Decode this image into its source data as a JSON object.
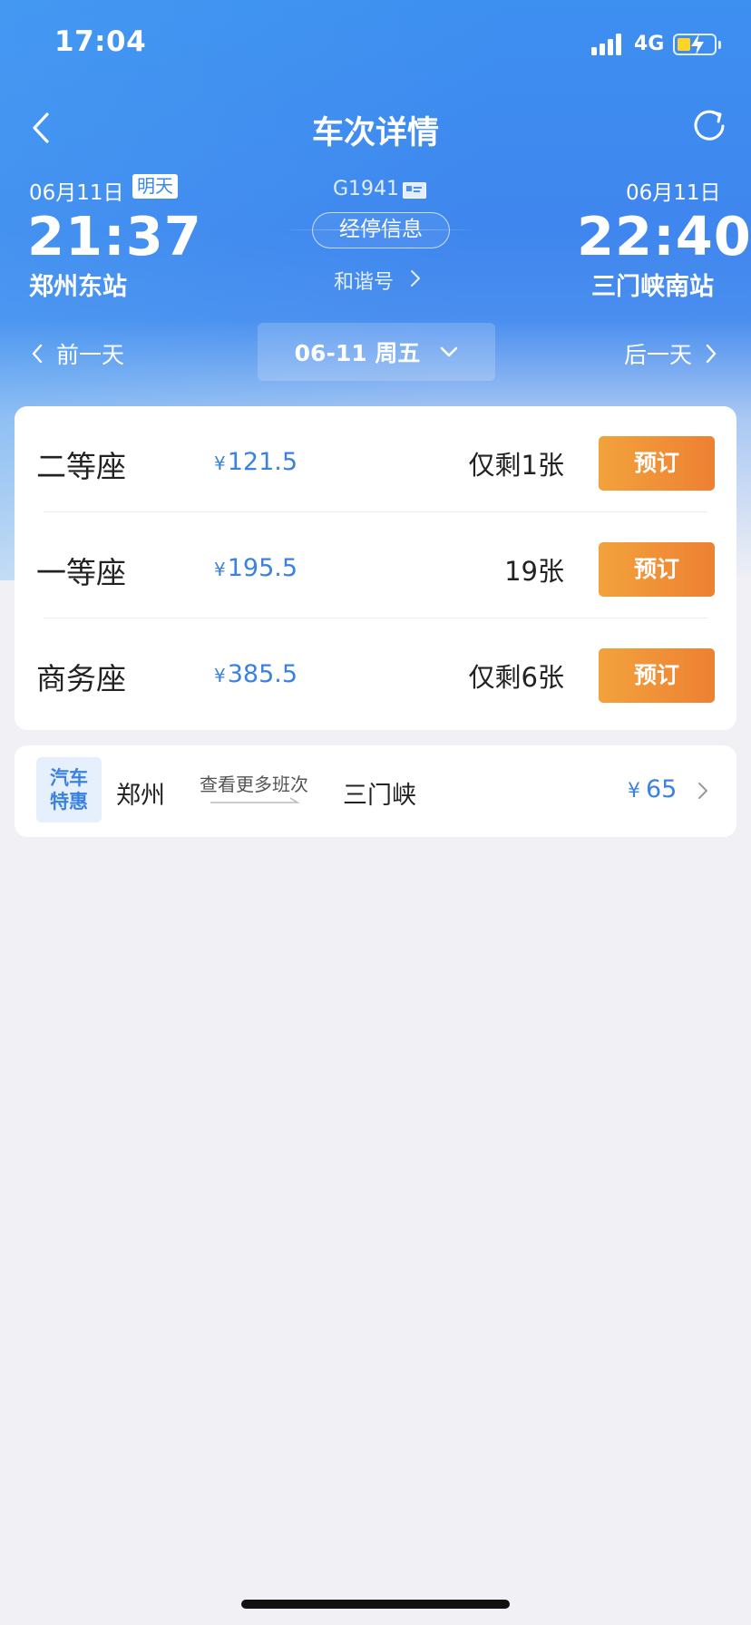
{
  "status_bar": {
    "time": "17:04",
    "network": "4G",
    "battery_color": "#ffd426"
  },
  "nav": {
    "title": "车次详情",
    "back_icon": "chevron-left-icon",
    "refresh_icon": "refresh-icon"
  },
  "train": {
    "departure": {
      "date": "06月11日",
      "badge": "明天",
      "time": "21:37",
      "station": "郑州东站"
    },
    "number": "G1941",
    "stops_label": "经停信息",
    "type_label": "和谐号",
    "arrival": {
      "date": "06月11日",
      "time": "22:40",
      "station": "三门峡南站"
    }
  },
  "date_switch": {
    "prev_label": "前一天",
    "current": "06-11 周五",
    "next_label": "后一天"
  },
  "seats": [
    {
      "name": "二等座",
      "currency": "¥",
      "price": "121.5",
      "availability": "仅剩1张",
      "button": "预订"
    },
    {
      "name": "一等座",
      "currency": "¥",
      "price": "195.5",
      "availability": "19张",
      "button": "预订"
    },
    {
      "name": "商务座",
      "currency": "¥",
      "price": "385.5",
      "availability": "仅剩6张",
      "button": "预订"
    }
  ],
  "bus_promo": {
    "badge_line1": "汽车",
    "badge_line2": "特惠",
    "from": "郑州",
    "more_label": "查看更多班次",
    "to": "三门峡",
    "currency": "¥",
    "price": "65"
  },
  "colors": {
    "accent_blue": "#3b82e0",
    "book_orange": "#ee8033",
    "header_blue": "#3d8ff0"
  }
}
